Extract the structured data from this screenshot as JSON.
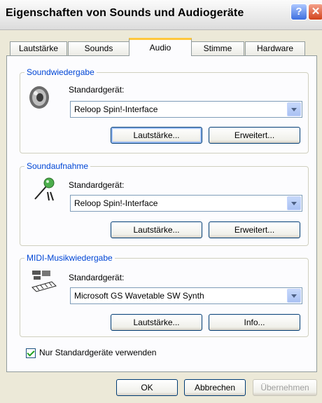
{
  "window": {
    "title": "Eigenschaften von Sounds und Audiogeräte"
  },
  "tabs": [
    "Lautstärke",
    "Sounds",
    "Audio",
    "Stimme",
    "Hardware"
  ],
  "active_tab": "Audio",
  "playback": {
    "group_label": "Soundwiedergabe",
    "device_label": "Standardgerät:",
    "device_value": "Reloop Spin!-Interface",
    "volume_button": "Lautstärke...",
    "advanced_button": "Erweitert..."
  },
  "recording": {
    "group_label": "Soundaufnahme",
    "device_label": "Standardgerät:",
    "device_value": "Reloop Spin!-Interface",
    "volume_button": "Lautstärke...",
    "advanced_button": "Erweitert..."
  },
  "midi": {
    "group_label": "MIDI-Musikwiedergabe",
    "device_label": "Standardgerät:",
    "device_value": "Microsoft GS Wavetable SW Synth",
    "volume_button": "Lautstärke...",
    "info_button": "Info..."
  },
  "only_default_devices": {
    "label": "Nur Standardgeräte verwenden",
    "checked": true
  },
  "footer": {
    "ok": "OK",
    "cancel": "Abbrechen",
    "apply": "Übernehmen"
  },
  "colors": {
    "accent": "#0046d5",
    "tab_highlight": "#ffc73c"
  }
}
